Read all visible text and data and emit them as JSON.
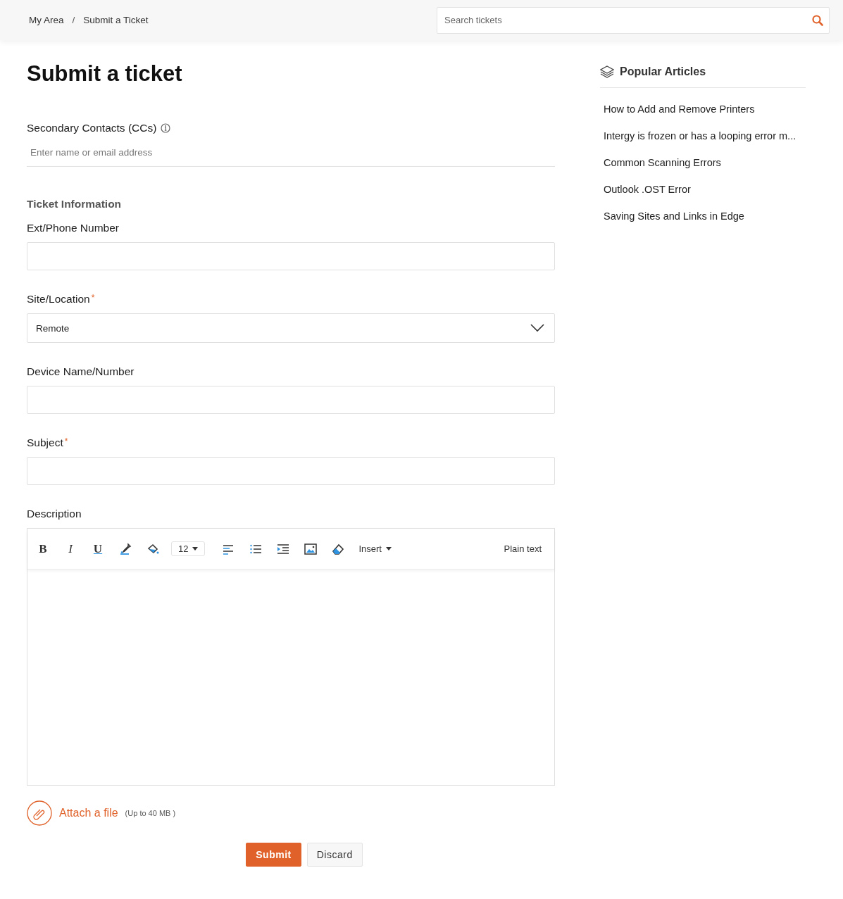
{
  "breadcrumb": [
    {
      "label": "My Area"
    },
    {
      "label": "Submit a Ticket"
    }
  ],
  "breadcrumb_separator": "/",
  "search": {
    "placeholder": "Search tickets"
  },
  "title": "Submit a ticket",
  "cc": {
    "label": "Secondary Contacts (CCs)",
    "placeholder": "Enter name or email address"
  },
  "section_title": "Ticket Information",
  "required_mark": "*",
  "fields": [
    {
      "kind": "text",
      "label": "Ext/Phone Number",
      "required": false
    },
    {
      "kind": "select",
      "label": "Site/Location",
      "required": true,
      "value": "Remote"
    },
    {
      "kind": "text",
      "label": "Device Name/Number",
      "required": false
    },
    {
      "kind": "text",
      "label": "Subject",
      "required": true
    },
    {
      "kind": "editor",
      "label": "Description",
      "required": false
    }
  ],
  "toolbar": [
    {
      "kind": "glyph",
      "label": "B"
    },
    {
      "kind": "glyph",
      "label": "I"
    },
    {
      "kind": "glyph",
      "label": "U"
    },
    {
      "kind": "icon"
    },
    {
      "kind": "icon"
    },
    {
      "kind": "select",
      "label": "12"
    },
    {
      "kind": "icon"
    },
    {
      "kind": "icon"
    },
    {
      "kind": "icon"
    },
    {
      "kind": "icon"
    },
    {
      "kind": "icon"
    },
    {
      "kind": "menu",
      "label": "Insert"
    }
  ],
  "plain_text": "Plain text",
  "attach": {
    "label": "Attach a file",
    "limit": "(Up to 40 MB )"
  },
  "buttons": [
    {
      "kind": "primary",
      "label": "Submit"
    },
    {
      "kind": "secondary",
      "label": "Discard"
    }
  ],
  "sidebar": {
    "title": "Popular Articles",
    "articles": [
      {
        "title": "How to Add and Remove Printers"
      },
      {
        "title": "Intergy is frozen or has a looping error m..."
      },
      {
        "title": "Common Scanning Errors"
      },
      {
        "title": "Outlook .OST Error"
      },
      {
        "title": "Saving Sites and Links in Edge"
      }
    ]
  }
}
